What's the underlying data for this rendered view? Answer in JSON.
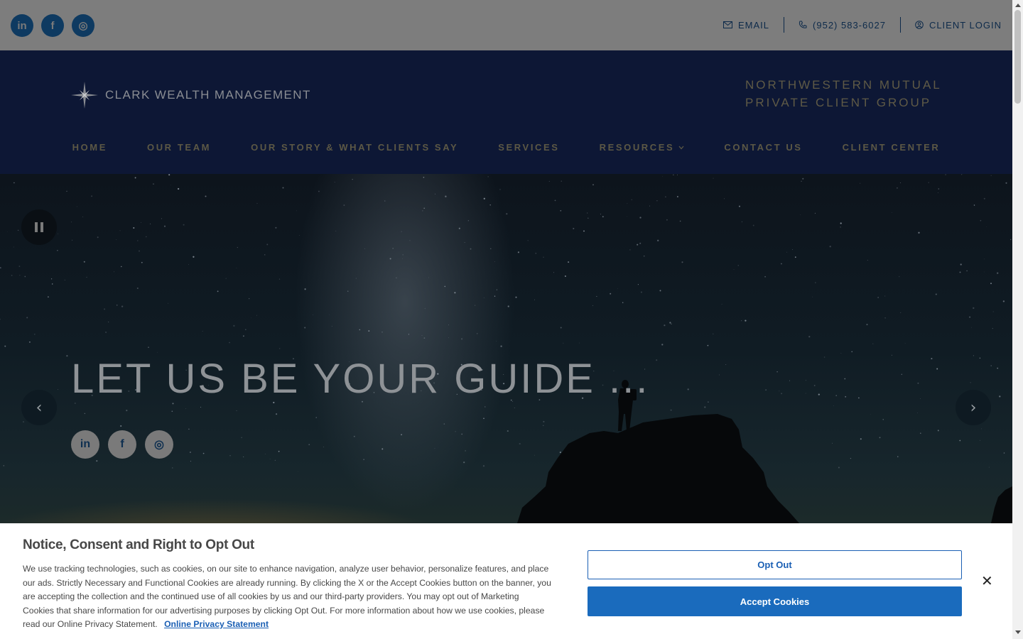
{
  "topbar": {
    "social": [
      {
        "label": "in",
        "icon": "linkedin-icon"
      },
      {
        "label": "f",
        "icon": "facebook-icon"
      },
      {
        "label": "◎",
        "icon": "instagram-icon"
      }
    ],
    "email_label": "EMAIL",
    "phone_label": "(952) 583-6027",
    "login_label": "CLIENT LOGIN"
  },
  "header": {
    "logo_text": "CLARK WEALTH MANAGEMENT",
    "group_line1": "NORTHWESTERN MUTUAL",
    "group_line2": "PRIVATE CLIENT GROUP"
  },
  "nav": {
    "items": [
      "HOME",
      "OUR TEAM",
      "OUR STORY & WHAT CLIENTS SAY",
      "SERVICES",
      "RESOURCES",
      "CONTACT US",
      "CLIENT CENTER"
    ]
  },
  "hero": {
    "title": "LET US BE YOUR GUIDE ...",
    "prev_label": "‹",
    "next_label": "›",
    "social": [
      {
        "label": "in",
        "icon": "linkedin-icon"
      },
      {
        "label": "f",
        "icon": "facebook-icon"
      },
      {
        "label": "◎",
        "icon": "instagram-icon"
      }
    ]
  },
  "cookie": {
    "title": "Notice, Consent and Right to Opt Out",
    "body": "We use tracking technologies, such as cookies, on our site to enhance navigation, analyze user behavior, personalize features, and place our ads. Strictly Necessary and Functional Cookies are already running. By clicking the X or the Accept Cookies button on the banner, you are accepting the collection and the continued use of all cookies by us and our third-party providers. You may opt out of Marketing Cookies that share information for our advertising purposes by clicking Opt Out. For more information about how we use cookies, please read our Online Privacy Statement.",
    "link_label": "Online Privacy Statement",
    "opt_out_label": "Opt Out",
    "accept_label": "Accept Cookies",
    "close_label": "✕"
  },
  "colors": {
    "brand_navy": "#0d1735",
    "accept_blue": "#1a6bbd",
    "nav_gold": "#5c5845"
  }
}
